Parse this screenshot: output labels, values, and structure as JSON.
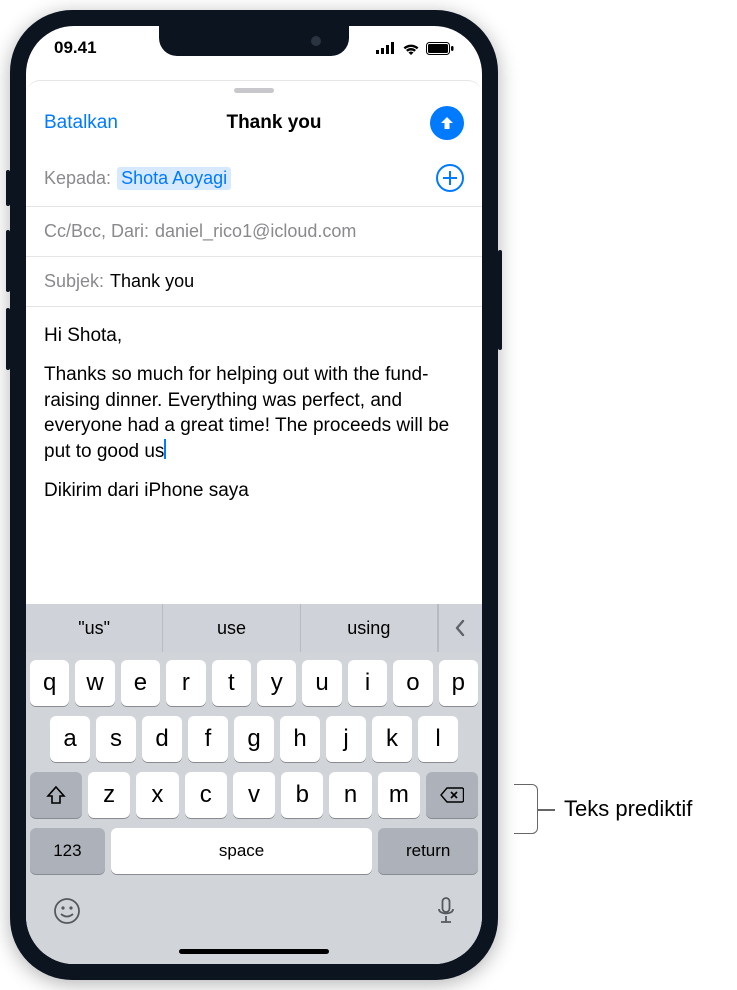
{
  "status": {
    "time": "09.41"
  },
  "header": {
    "cancel": "Batalkan",
    "title": "Thank you"
  },
  "fields": {
    "toLabel": "Kepada:",
    "toRecipient": "Shota Aoyagi",
    "ccLabel": "Cc/Bcc, Dari:",
    "ccValue": "daniel_rico1@icloud.com",
    "subjectLabel": "Subjek:",
    "subjectValue": "Thank you"
  },
  "body": {
    "greeting": "Hi Shota,",
    "paragraph": "Thanks so much for helping out with the fund-raising dinner. Everything was perfect, and everyone had a great time! The proceeds will be put to good us",
    "signature": "Dikirim dari iPhone saya"
  },
  "predictive": {
    "s1": "\"us\"",
    "s2": "use",
    "s3": "using"
  },
  "keys": {
    "row1": [
      "q",
      "w",
      "e",
      "r",
      "t",
      "y",
      "u",
      "i",
      "o",
      "p"
    ],
    "row2": [
      "a",
      "s",
      "d",
      "f",
      "g",
      "h",
      "j",
      "k",
      "l"
    ],
    "row3": [
      "z",
      "x",
      "c",
      "v",
      "b",
      "n",
      "m"
    ],
    "num": "123",
    "space": "space",
    "return": "return"
  },
  "callout": "Teks prediktif"
}
